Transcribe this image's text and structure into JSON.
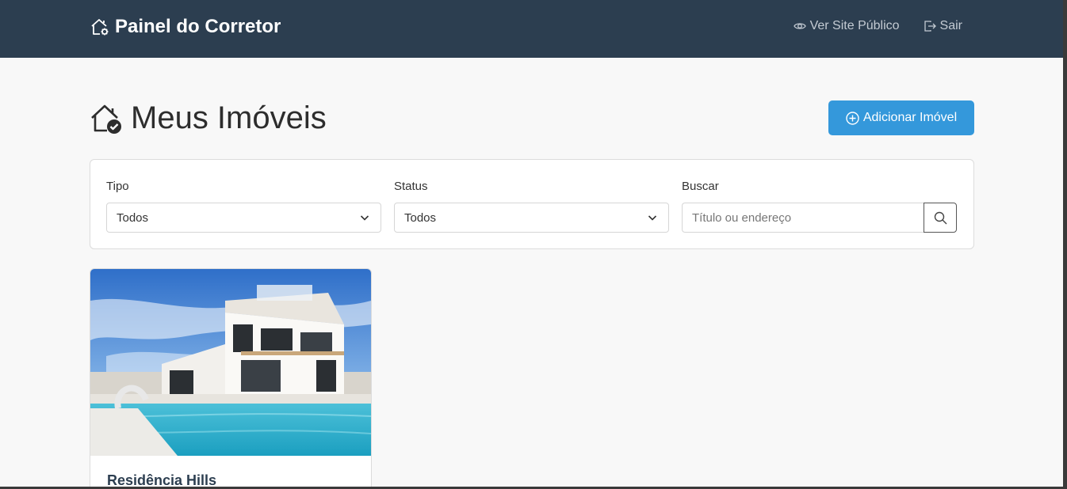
{
  "navbar": {
    "brand": "Painel do Corretor",
    "links": [
      {
        "label": "Ver Site Público",
        "icon": "eye-icon"
      },
      {
        "label": "Sair",
        "icon": "logout-icon"
      }
    ]
  },
  "page": {
    "title": "Meus Imóveis",
    "add_button": "Adicionar Imóvel"
  },
  "filters": {
    "tipo_label": "Tipo",
    "tipo_value": "Todos",
    "status_label": "Status",
    "status_value": "Todos",
    "search_label": "Buscar",
    "search_placeholder": "Título ou endereço",
    "search_value": ""
  },
  "properties": [
    {
      "title": "Residência Hills",
      "image": "modern-villa-with-pool"
    }
  ],
  "colors": {
    "navbar": "#2c3e50",
    "accent": "#3498db",
    "background": "#f8f8f8"
  }
}
